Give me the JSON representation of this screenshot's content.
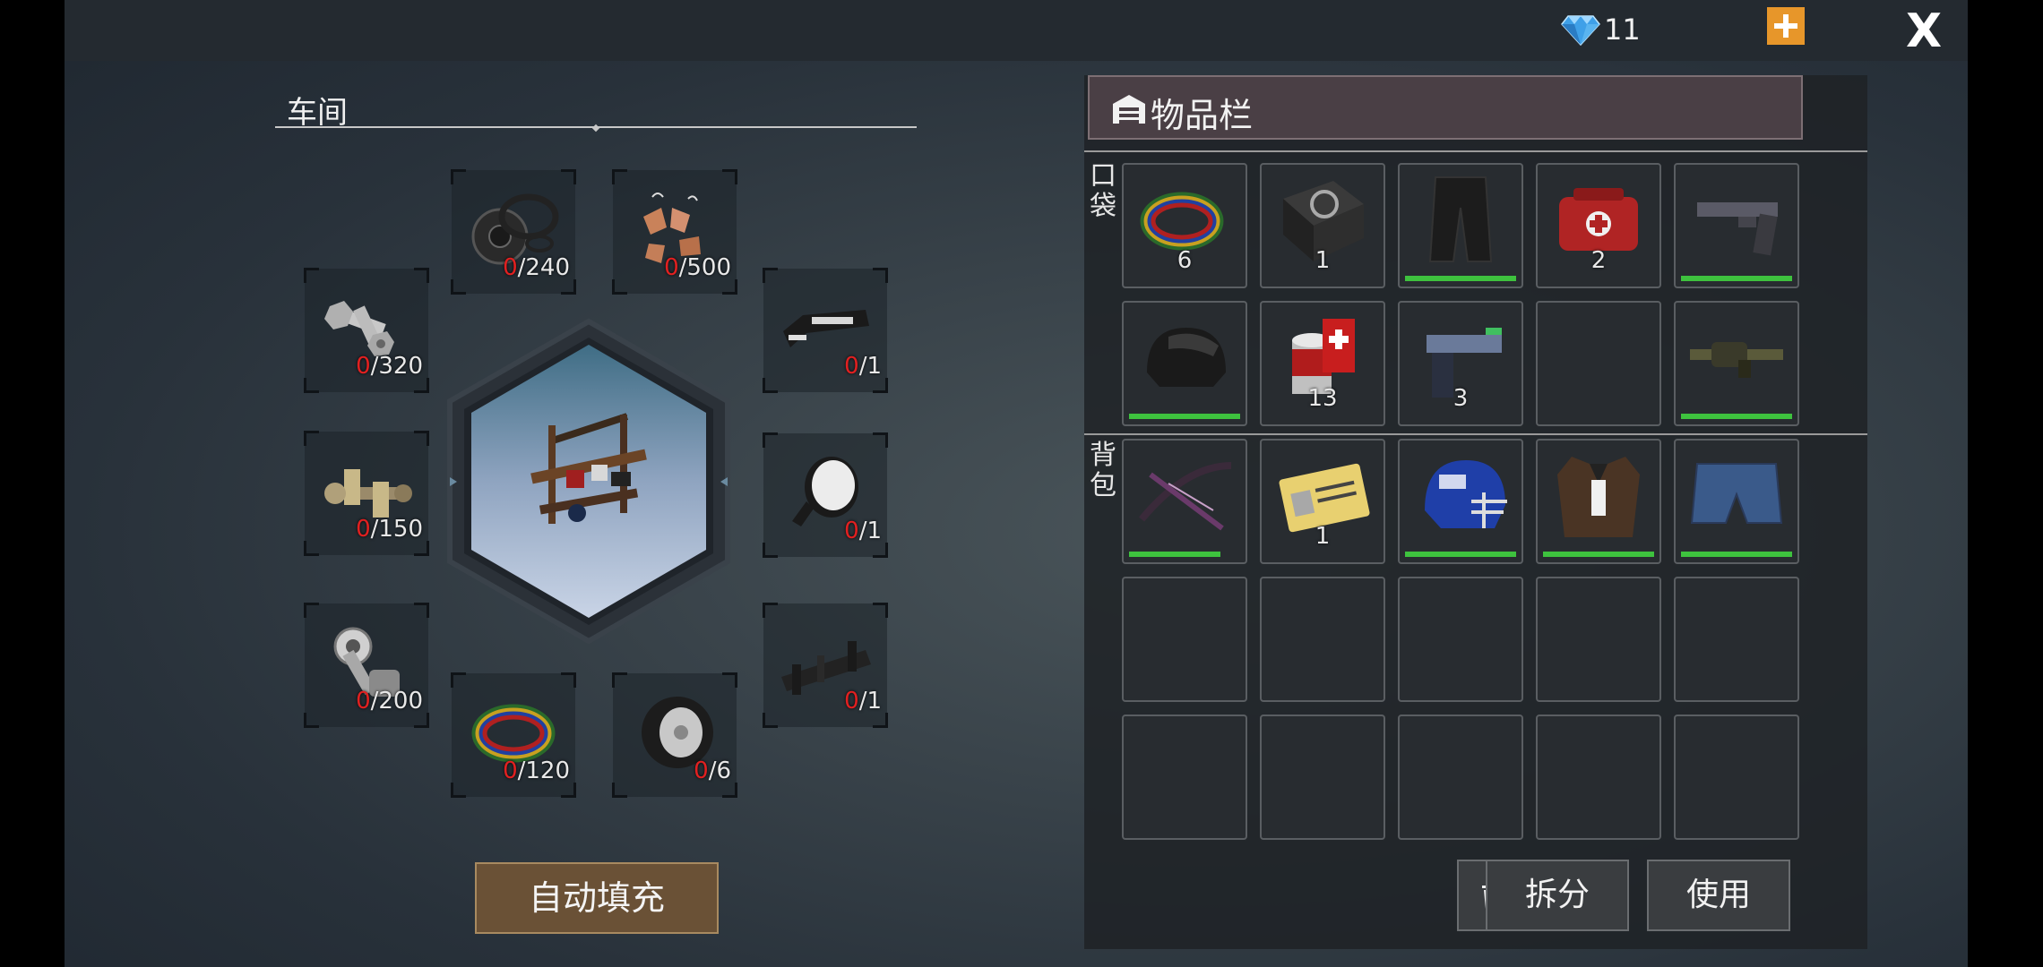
{
  "topbar": {
    "gems": "11"
  },
  "workshop": {
    "title": "车间",
    "slots": [
      {
        "name": "gasket",
        "have": "0",
        "need": "/240"
      },
      {
        "name": "copper-scrap",
        "have": "0",
        "need": "/500"
      },
      {
        "name": "bolts",
        "have": "0",
        "need": "/320"
      },
      {
        "name": "bumper",
        "have": "0",
        "need": "/1"
      },
      {
        "name": "crankshaft",
        "have": "0",
        "need": "/150"
      },
      {
        "name": "side-mirror",
        "have": "0",
        "need": "/1"
      },
      {
        "name": "piston",
        "have": "0",
        "need": "/200"
      },
      {
        "name": "chassis",
        "have": "0",
        "need": "/1"
      },
      {
        "name": "wires",
        "have": "0",
        "need": "/120"
      },
      {
        "name": "tire",
        "have": "0",
        "need": "/6"
      }
    ],
    "autofill_label": "自动填充"
  },
  "inventory": {
    "title": "物品栏",
    "pocket_label": "口袋",
    "backpack_label": "背包",
    "pocket": [
      {
        "icon": "wire-coil-icon",
        "qty": "6",
        "durability": null
      },
      {
        "icon": "manual-book-icon",
        "qty": "1",
        "durability": null
      },
      {
        "icon": "black-pants-icon",
        "qty": "",
        "durability": 1.0
      },
      {
        "icon": "medkit-bag-icon",
        "qty": "2",
        "durability": null
      },
      {
        "icon": "pistol-icon",
        "qty": "",
        "durability": 1.0
      },
      {
        "icon": "motorcycle-helmet-icon",
        "qty": "",
        "durability": 1.0
      },
      {
        "icon": "bandage-icon",
        "qty": "13",
        "durability": null
      },
      {
        "icon": "flare-gun-icon",
        "qty": "3",
        "durability": null
      },
      {
        "icon": "empty",
        "qty": "",
        "durability": null
      },
      {
        "icon": "grenade-launcher-icon",
        "qty": "",
        "durability": 1.0
      }
    ],
    "backpack": [
      {
        "icon": "crossbow-icon",
        "qty": "",
        "durability": 0.82
      },
      {
        "icon": "access-card-icon",
        "qty": "1",
        "durability": null
      },
      {
        "icon": "football-helmet-icon",
        "qty": "",
        "durability": 1.0
      },
      {
        "icon": "leather-vest-icon",
        "qty": "",
        "durability": 1.0
      },
      {
        "icon": "denim-shorts-icon",
        "qty": "",
        "durability": 1.0
      }
    ],
    "split_label": "拆分",
    "use_label": "使用"
  }
}
